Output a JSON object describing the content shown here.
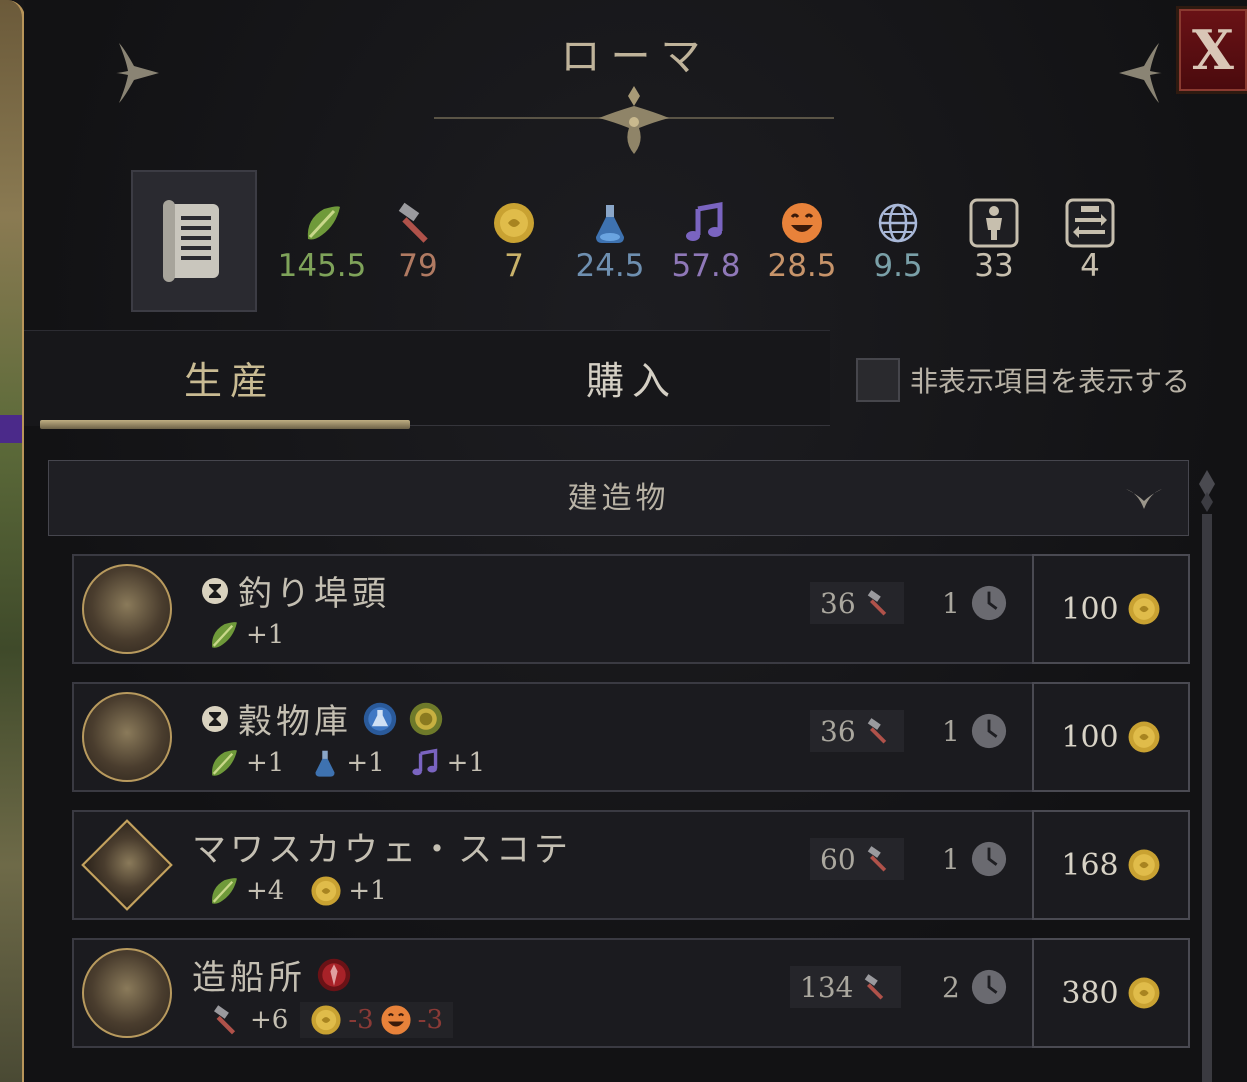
{
  "window": {
    "title": "ローマ",
    "close_label": "X"
  },
  "stats": [
    {
      "icon": "food-icon",
      "value": "145.5",
      "color": "#7fa35a"
    },
    {
      "icon": "production-hammer-icon",
      "value": "79",
      "color": "#b07a62"
    },
    {
      "icon": "gold-coin-icon",
      "value": "7",
      "color": "#c9b26a"
    },
    {
      "icon": "science-flask-icon",
      "value": "24.5",
      "color": "#6e8fb0"
    },
    {
      "icon": "culture-music-icon",
      "value": "57.8",
      "color": "#8f78b8"
    },
    {
      "icon": "happiness-face-icon",
      "value": "28.5",
      "color": "#c7946a"
    },
    {
      "icon": "influence-globe-icon",
      "value": "9.5",
      "color": "#7aa0a8"
    },
    {
      "icon": "population-icon",
      "value": "33",
      "color": "#c7bfae"
    },
    {
      "icon": "trade-routes-icon",
      "value": "4",
      "color": "#c7bfae"
    }
  ],
  "tabs": {
    "production": "生産",
    "purchase": "購入"
  },
  "show_hidden_label": "非表示項目を表示する",
  "category": "建造物",
  "items": [
    {
      "name": "釣り埠頭",
      "effects": [
        {
          "value": "+1"
        }
      ],
      "cost": "36",
      "turns": "1",
      "price": "100"
    },
    {
      "name": "穀物庫",
      "effects": [
        {
          "value": "+1"
        },
        {
          "value": "+1"
        },
        {
          "value": "+1"
        }
      ],
      "cost": "36",
      "turns": "1",
      "price": "100"
    },
    {
      "name": "マワスカウェ・スコテ",
      "effects": [
        {
          "value": "+4"
        },
        {
          "value": "+1"
        }
      ],
      "cost": "60",
      "turns": "1",
      "price": "168"
    },
    {
      "name": "造船所",
      "effects": [
        {
          "value": "+6"
        },
        {
          "value": "-3"
        },
        {
          "value": "-3"
        }
      ],
      "cost": "134",
      "turns": "2",
      "price": "380"
    }
  ]
}
